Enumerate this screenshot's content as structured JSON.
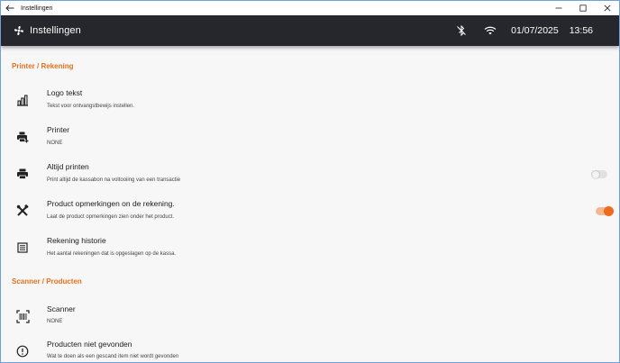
{
  "window": {
    "title": "Instellingen"
  },
  "appbar": {
    "title": "Instellingen",
    "date": "01/07/2025",
    "time": "13:56"
  },
  "colors": {
    "accent": "#ee6b1e",
    "header_bg": "#26272c"
  },
  "sections": [
    {
      "title": "Printer / Rekening"
    },
    {
      "title": "Scanner / Producten"
    }
  ],
  "settings": {
    "logo": {
      "title": "Logo tekst",
      "subtitle": "Tekst voor ontvangstbewijs instellen.",
      "icon": "chart-icon"
    },
    "printer": {
      "title": "Printer",
      "subtitle": "NONE",
      "icon": "printer-add-icon"
    },
    "always_print": {
      "title": "Altijd printen",
      "subtitle": "Print altijd de kassabon na voltooiing van een transactie",
      "icon": "printer-icon",
      "toggle": false
    },
    "product_remarks": {
      "title": "Product opmerkingen on de rekening.",
      "subtitle": "Laat de product opmerkingen zien onder het product.",
      "icon": "tools-icon",
      "toggle": true
    },
    "history": {
      "title": "Rekening historie",
      "subtitle": "Het aantal rekeningen dat is opgeslagen op de kassa.",
      "icon": "list-icon"
    },
    "scanner": {
      "title": "Scanner",
      "subtitle": "NONE",
      "icon": "barcode-scan-icon"
    },
    "not_found": {
      "title": "Producten niet gevonden",
      "subtitle": "Wat te doen als een gescand item niet wordt gevonden",
      "icon": "alert-circle-icon"
    }
  }
}
